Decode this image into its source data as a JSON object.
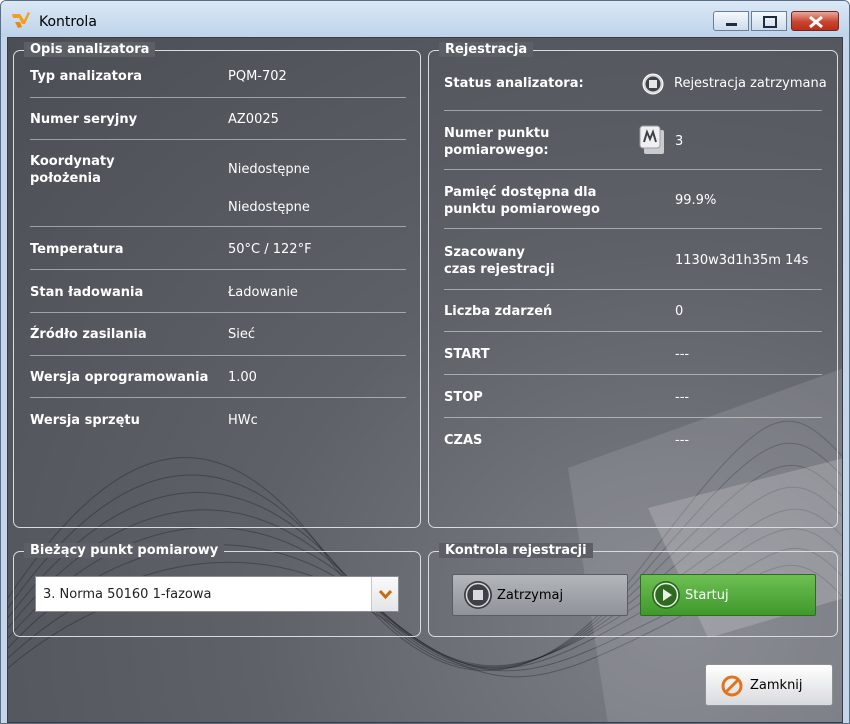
{
  "window": {
    "title": "Kontrola"
  },
  "analyzer": {
    "heading": "Opis analizatora",
    "rows": [
      {
        "label": "Typ analizatora",
        "value": "PQM-702"
      },
      {
        "label": "Numer seryjny",
        "value": "AZ0025"
      },
      {
        "label": "Koordynaty\npołożenia",
        "value": "Niedostępne",
        "value2": "Niedostępne"
      },
      {
        "label": "Temperatura",
        "value": "50°C / 122°F"
      },
      {
        "label": "Stan ładowania",
        "value": "Ładowanie"
      },
      {
        "label": "Źródło zasilania",
        "value": "Sieć"
      },
      {
        "label": "Wersja oprogramowania",
        "value": "1.00"
      },
      {
        "label": "Wersja sprzętu",
        "value": "HWc"
      }
    ]
  },
  "registration": {
    "heading": "Rejestracja",
    "rows": [
      {
        "label": "Status analizatora:",
        "value": "Rejestracja zatrzymana"
      },
      {
        "label": "Numer punktu\npomiarowego:",
        "value": "3"
      },
      {
        "label": "Pamięć dostępna dla\npunktu pomiarowego",
        "value": "99.9%"
      },
      {
        "label": "Szacowany\nczas rejestracji",
        "value": "1130w3d1h35m 14s"
      },
      {
        "label": "Liczba zdarzeń",
        "value": "0"
      },
      {
        "label": "START",
        "value": "---"
      },
      {
        "label": "STOP",
        "value": "---"
      },
      {
        "label": "CZAS",
        "value": "---"
      }
    ]
  },
  "current_point": {
    "heading": "Bieżący punkt pomiarowy",
    "selected": "3. Norma 50160 1-fazowa"
  },
  "control": {
    "heading": "Kontrola rejestracji",
    "stop_label": "Zatrzymaj",
    "start_label": "Startuj"
  },
  "close_label": "Zamknij",
  "colors": {
    "start_green": "#4aa635",
    "panel_bg": "#5c5f66"
  }
}
